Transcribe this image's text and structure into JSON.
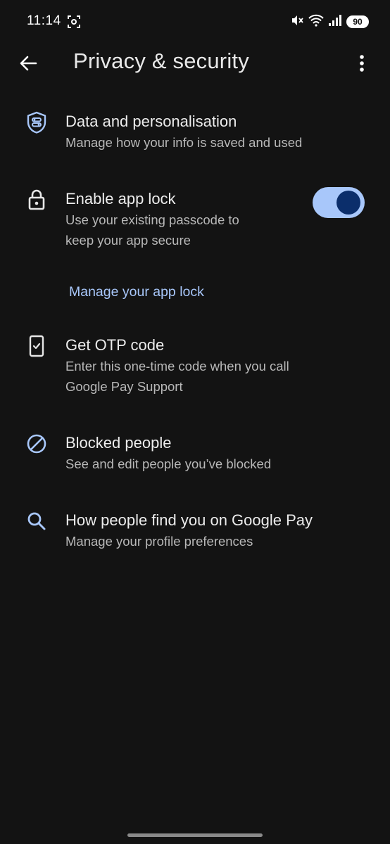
{
  "status_bar": {
    "time": "11:14",
    "battery": "90"
  },
  "header": {
    "title": "Privacy & security"
  },
  "items": [
    {
      "title": "Data and personalisation",
      "subtitle": "Manage how your info is saved and used",
      "icon": "shield-icon"
    },
    {
      "title": "Enable app lock",
      "subtitle_line1": "Use your existing passcode to",
      "subtitle_line2": "keep your app secure",
      "icon": "lock-icon",
      "toggle_on": true
    },
    {
      "title": "Get OTP code",
      "subtitle_line1": "Enter this one-time code when you call",
      "subtitle_line2": "Google Pay Support",
      "icon": "phone-check-icon"
    },
    {
      "title": "Blocked people",
      "subtitle": "See and edit people you’ve blocked",
      "icon": "block-icon"
    },
    {
      "title": "How people find you on Google Pay",
      "subtitle": "Manage your profile preferences",
      "icon": "search-icon"
    }
  ],
  "manage_app_lock_link": "Manage your app lock",
  "colors": {
    "background": "#131313",
    "accent": "#a8c7fa",
    "toggle_knob": "#0b2e6b"
  }
}
